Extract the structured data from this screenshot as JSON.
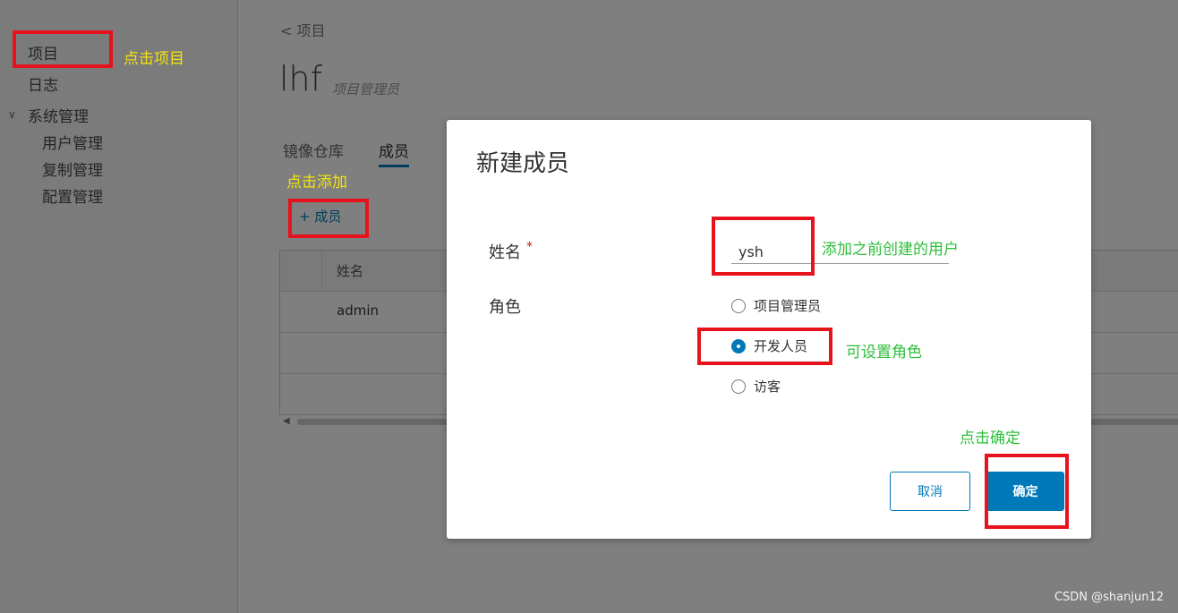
{
  "sidebar": {
    "items": [
      {
        "label": "项目"
      },
      {
        "label": "日志"
      },
      {
        "label": "系统管理"
      }
    ],
    "sub_items": [
      {
        "label": "用户管理"
      },
      {
        "label": "复制管理"
      },
      {
        "label": "配置管理"
      }
    ]
  },
  "main": {
    "breadcrumb": "< 项目",
    "project_name": "lhf",
    "project_role": "项目管理员",
    "tabs": [
      {
        "label": "镜像仓库"
      },
      {
        "label": "成员"
      }
    ],
    "add_member_label": "成员",
    "table": {
      "header": "姓名",
      "rows": [
        "admin"
      ]
    }
  },
  "modal": {
    "title": "新建成员",
    "name_label": "姓名",
    "required_mark": "*",
    "name_value": "ysh",
    "role_label": "角色",
    "roles": [
      {
        "label": "项目管理员",
        "selected": false
      },
      {
        "label": "开发人员",
        "selected": true
      },
      {
        "label": "访客",
        "selected": false
      }
    ],
    "cancel_label": "取消",
    "ok_label": "确定"
  },
  "annotations": {
    "click_project": "点击项目",
    "click_add": "点击添加",
    "add_user": "添加之前创建的用户",
    "set_role": "可设置角色",
    "click_ok": "点击确定"
  },
  "watermark": "CSDN @shanjun12",
  "colors": {
    "accent": "#0079b8",
    "highlight": "#e8121c",
    "note_yellow": "#f5e30c",
    "note_green": "#2dbf3a"
  }
}
